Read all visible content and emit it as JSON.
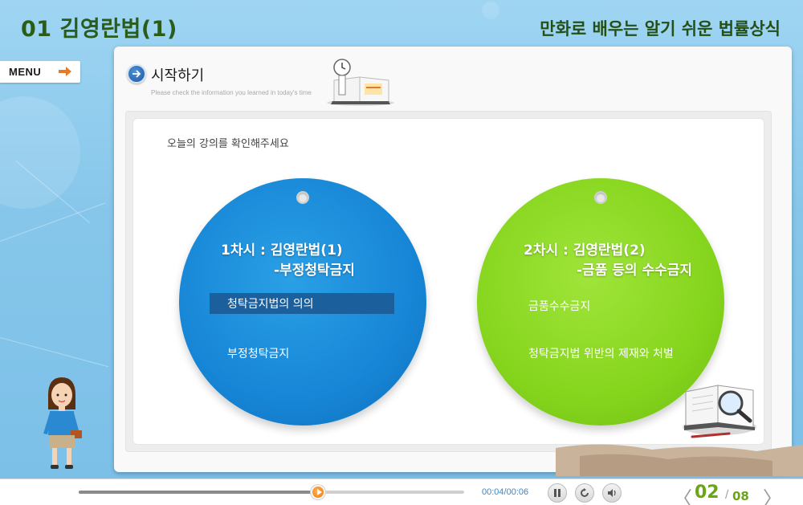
{
  "header": {
    "lesson_title": "01 김영란법(1)",
    "series_title": "만화로 배우는 알기 쉬운 법률상식"
  },
  "menu": {
    "label": "MENU",
    "icon": "arrow-right-icon"
  },
  "section": {
    "title": "시작하기",
    "subtitle": "Please check the information you learned in today's time",
    "icon": "arrow-circle-icon"
  },
  "instruction": "오늘의 강의를 확인해주세요",
  "sessions": [
    {
      "head_line1": "1차시 :  김영란법(1)",
      "head_line2": "-부정청탁금지",
      "items": [
        {
          "label": "청탁금지법의 의의",
          "active": true
        },
        {
          "label": "부정청탁금지",
          "active": false
        }
      ],
      "color": "#1786d6"
    },
    {
      "head_line1": "2차시 : 김영란법(2)",
      "head_line2": "-금품  등의  수수금지",
      "items": [
        {
          "label": "금품수수금지",
          "active": false
        },
        {
          "label": "청탁금지법  위반의  제재와  처벌",
          "active": false
        }
      ],
      "color": "#86d51d"
    }
  ],
  "player": {
    "time": "00:04/00:06",
    "progress": 0.62,
    "buttons": [
      "pause-icon",
      "replay-icon",
      "volume-icon"
    ],
    "page_current": "02",
    "page_separator": "/",
    "page_total": "08",
    "prev_glyph": "〈",
    "next_glyph": "〉"
  },
  "colors": {
    "lesson_title": "#2b5d1a",
    "accent_blue": "#1786d6",
    "accent_green": "#86d51d",
    "page_number": "#6aa516"
  }
}
